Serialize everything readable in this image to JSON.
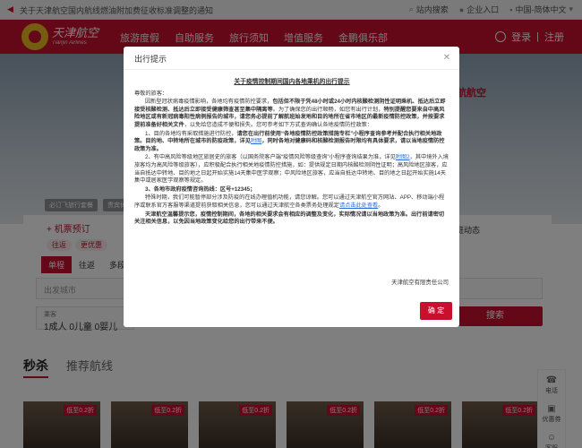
{
  "topbar": {
    "notice": "关于天津航空国内航线燃油附加费征收标准调整的通知",
    "links": [
      {
        "label": "站内搜索"
      },
      {
        "label": "企业入口"
      },
      {
        "label": "中国-简体中文"
      }
    ]
  },
  "header": {
    "logo_text": "天津航空",
    "logo_sub": "Tianjin Airlines",
    "nav": [
      "旅游度假",
      "自助服务",
      "旅行须知",
      "增值服务",
      "金鹏俱乐部"
    ],
    "login": "登录",
    "register": "注册"
  },
  "page": {
    "hero_right": "航航空",
    "chips": [
      "必订飞旅行套餐",
      "贵宾休息"
    ],
    "announce": "航班动态",
    "booking_title": "+ 机票预订",
    "pills": [
      "往返",
      "更优惠"
    ],
    "tabs": [
      "单程",
      "往返",
      "多段联"
    ],
    "from_placeholder": "出发城市",
    "pax_label": "乘客",
    "pax_value": "1成人  0儿童  0婴儿",
    "search_button": "搜索",
    "section_main": "秒杀",
    "section_alt": "推荐航线",
    "card_tag": "低至0.2折",
    "side": [
      {
        "label": "电话",
        "icon": "phone-icon"
      },
      {
        "label": "优惠券",
        "icon": "coupon-icon"
      },
      {
        "label": "客服",
        "icon": "service-icon"
      }
    ]
  },
  "modal": {
    "title": "出行提示",
    "heading": "关于疫情控制期间国内各地乘机的出行提示",
    "greeting": "尊敬的旅客：",
    "p1_a": "因新型冠状病毒疫情影响，各地均有疫情防控要求，",
    "p1_b": "包括但不限于凭48小时或24小时内核酸检测阴性证明乘机、抵达后立即接受核酸检测、抵达后立即接受健康筛查甚至集中隔离等",
    "p1_c": "。为了确保您的出行顺畅，如您有出行计划，",
    "p1_d": "特别提醒您要来自中高风险地区或有新冠病毒阳性病例报告的城市，请您务必提前了解航班始发地和目的地所在省市地区的最新疫情防控政策，并按要求提前准备好相关文件",
    "p1_e": "，以免给您造成不便和损失。您可参考如下方式查询确认各地疫情防控政策：",
    "p2_a": "1、目的各地均有采取措施进行防控，",
    "p2_b": "请您在出行前使用“各地疫情防控政策措施专栏”小程序查询参考并配合执行相关地政策。目的地、中转地所在城市的防疫政策，详见",
    "p2_link": "附图",
    "p2_c": "，同时各地对健康码和核酸检测报告时限均有具体要求，请以当地疫情防控政策为准。",
    "p3_a": "2、有中高风险等级地区旅居史的旅客（以国务院客户端“疫情风险等级查询”小程序查询结果为准，详见",
    "p3_link": "附图2",
    "p3_b": "，其中境外入境旅客均为高风险等级旅客），应积极配合执行相关地疫情防控措施，如：提供规定日期内核酸检测阴性证明；高风险地区旅客，应当自抵达中转地、目的地之日起开始实施14天集中医学观察；中风险地区旅客，应当自抵达中转地、目的地之日起开始实施14天集中或居家医学观察等规定。",
    "p4": "3、各地市政府疫情咨询热线：区号+12345；",
    "p5_a": "特殊时期，我们可能暂停部分涉及防疫的在线办理值机功能，请您谅解。您可以通过天津航空官方网站、APP、移动端小程序或联系官方客服等渠道提前获取相关信息，您可以通过天津航空各类票务处理规定",
    "p5_link": "请点击此处查看",
    "p5_b": "。",
    "p6": "天津航空温馨提示您，疫情控制期间，各地的相关要求会有相应的调整及变化，实际情况请以当地政策为准。出行前请密切关注相关信息，以免因当地政策变化给您的出行带来不便。",
    "signature": "天津航空有限责任公司",
    "confirm": "确 定"
  }
}
